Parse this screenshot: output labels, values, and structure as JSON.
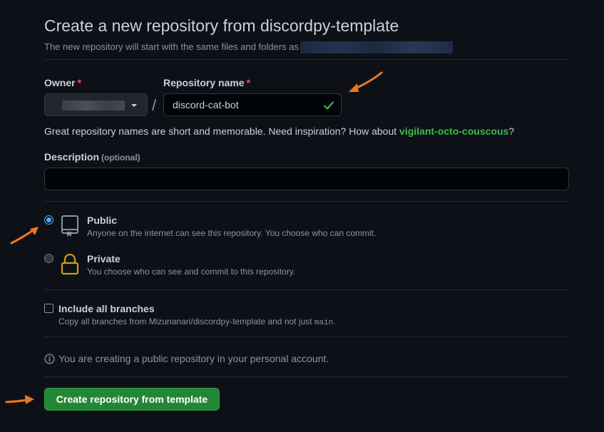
{
  "header": {
    "title": "Create a new repository from discordpy-template",
    "subtitle": "The new repository will start with the same files and folders as"
  },
  "owner": {
    "label": "Owner",
    "required_mark": "*"
  },
  "repo_name": {
    "label": "Repository name",
    "required_mark": "*",
    "value": "discord-cat-bot",
    "separator": "/"
  },
  "hint": {
    "text": "Great repository names are short and memorable. Need inspiration? How about ",
    "suggestion": "vigilant-octo-couscous",
    "suffix": "?"
  },
  "description": {
    "label": "Description",
    "optional": "(optional)",
    "value": ""
  },
  "visibility": {
    "public": {
      "title": "Public",
      "desc": "Anyone on the internet can see this repository. You choose who can commit.",
      "selected": true
    },
    "private": {
      "title": "Private",
      "desc": "You choose who can see and commit to this repository.",
      "selected": false
    }
  },
  "branches": {
    "title": "Include all branches",
    "desc_prefix": "Copy all branches from Mizunanari/discordpy-template and not just ",
    "desc_code": "main",
    "desc_suffix": ".",
    "checked": false
  },
  "info": {
    "text": "You are creating a public repository in your personal account."
  },
  "submit": {
    "label": "Create repository from template"
  },
  "colors": {
    "background": "#0d1117",
    "accent_green": "#238636",
    "suggestion_green": "#3fb950",
    "required_red": "#f85149",
    "radio_blue": "#58a6ff",
    "annotation_orange": "#f0761e",
    "lock_yellow": "#d29922"
  },
  "icons": [
    "caret-down-icon",
    "check-icon",
    "repo-icon",
    "lock-icon",
    "info-icon",
    "arrow-annotation-icon"
  ]
}
